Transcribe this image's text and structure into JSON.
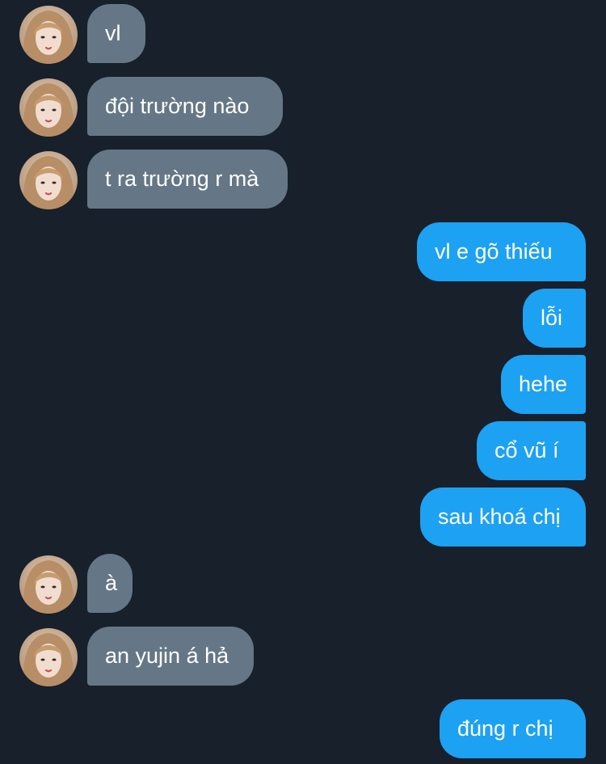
{
  "conversation": {
    "messages": [
      {
        "sender": "them",
        "text": "vl"
      },
      {
        "sender": "them",
        "text": "đội trường nào"
      },
      {
        "sender": "them",
        "text": "t ra trường r mà"
      },
      {
        "sender": "me",
        "text": "vl e gõ thiếu"
      },
      {
        "sender": "me",
        "text": "lỗi"
      },
      {
        "sender": "me",
        "text": "hehe"
      },
      {
        "sender": "me",
        "text": "cổ vũ í"
      },
      {
        "sender": "me",
        "text": "sau khoá chị"
      },
      {
        "sender": "them",
        "text": "à"
      },
      {
        "sender": "them",
        "text": "an yujin á hả"
      },
      {
        "sender": "me",
        "text": "đúng r chị"
      }
    ]
  },
  "colors": {
    "background": "#17202b",
    "incoming_bubble": "#657786",
    "outgoing_bubble": "#1da1f2",
    "text": "#ffffff"
  }
}
